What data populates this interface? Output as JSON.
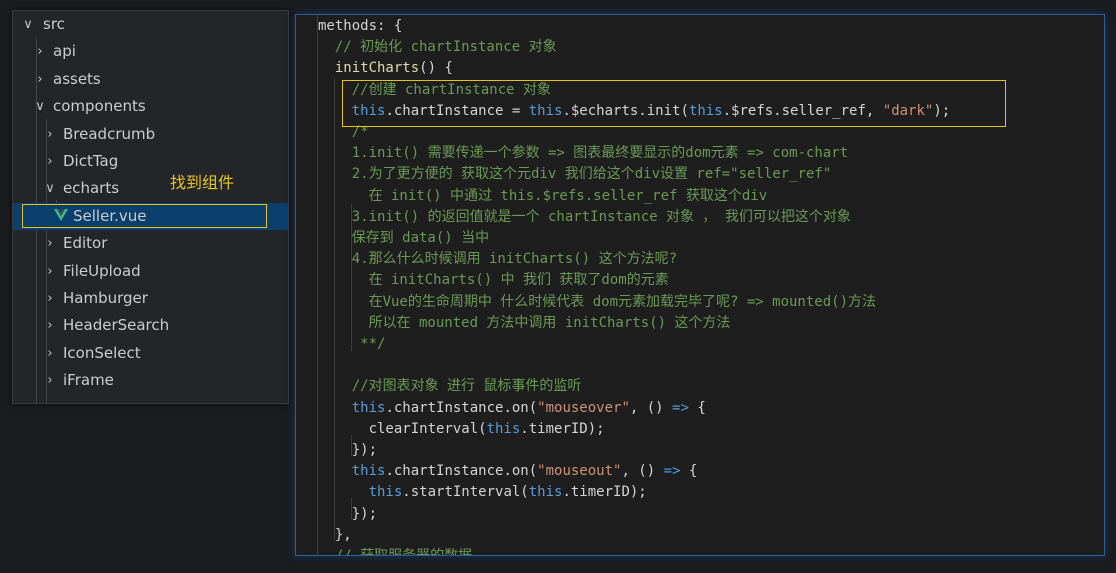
{
  "explorer": {
    "items": [
      {
        "label": "src",
        "chevron": "down",
        "depth": 0
      },
      {
        "label": "api",
        "chevron": "right",
        "depth": 1
      },
      {
        "label": "assets",
        "chevron": "right",
        "depth": 1
      },
      {
        "label": "components",
        "chevron": "down",
        "depth": 1
      },
      {
        "label": "Breadcrumb",
        "chevron": "right",
        "depth": 2
      },
      {
        "label": "DictTag",
        "chevron": "right",
        "depth": 2
      },
      {
        "label": "echarts",
        "chevron": "down",
        "depth": 2
      },
      {
        "label": "Seller.vue",
        "chevron": "",
        "depth": 3,
        "icon": "vue-icon",
        "selected": true
      },
      {
        "label": "Editor",
        "chevron": "right",
        "depth": 2
      },
      {
        "label": "FileUpload",
        "chevron": "right",
        "depth": 2
      },
      {
        "label": "Hamburger",
        "chevron": "right",
        "depth": 2
      },
      {
        "label": "HeaderSearch",
        "chevron": "right",
        "depth": 2
      },
      {
        "label": "IconSelect",
        "chevron": "right",
        "depth": 2
      },
      {
        "label": "iFrame",
        "chevron": "right",
        "depth": 2
      }
    ],
    "annotation": "找到组件"
  },
  "editor": {
    "lines": [
      [
        [
          "plain",
          "methods: {"
        ]
      ],
      [
        [
          "comment",
          "  // 初始化 chartInstance 对象"
        ]
      ],
      [
        [
          "func",
          "  initCharts"
        ],
        [
          "plain",
          "() {"
        ]
      ],
      [
        [
          "comment",
          "    //创建 chartInstance 对象"
        ]
      ],
      [
        [
          "keyword",
          "    this"
        ],
        [
          "plain",
          ".chartInstance = "
        ],
        [
          "keyword",
          "this"
        ],
        [
          "plain",
          ".$echarts.init("
        ],
        [
          "keyword",
          "this"
        ],
        [
          "plain",
          ".$refs.seller_ref, "
        ],
        [
          "string",
          "\"dark\""
        ],
        [
          "plain",
          ");"
        ]
      ],
      [
        [
          "comment",
          "    /*"
        ]
      ],
      [
        [
          "comment",
          "    1.init() 需要传递一个参数 => 图表最终要显示的dom元素 => com-chart"
        ]
      ],
      [
        [
          "comment",
          "    2.为了更方便的 获取这个元div 我们给这个div设置 ref=\"seller_ref\""
        ]
      ],
      [
        [
          "comment",
          "      在 init() 中通过 this.$refs.seller_ref 获取这个div"
        ]
      ],
      [
        [
          "comment",
          "    3.init() 的返回值就是一个 chartInstance 对象 ， 我们可以把这个对象"
        ]
      ],
      [
        [
          "comment",
          "    保存到 data() 当中"
        ]
      ],
      [
        [
          "comment",
          "    4.那么什么时候调用 initCharts() 这个方法呢?"
        ]
      ],
      [
        [
          "comment",
          "      在 initCharts() 中 我们 获取了dom的元素"
        ]
      ],
      [
        [
          "comment",
          "      在Vue的生命周期中 什么时候代表 dom元素加载完毕了呢? => mounted()方法"
        ]
      ],
      [
        [
          "comment",
          "      所以在 mounted 方法中调用 initCharts() 这个方法"
        ]
      ],
      [
        [
          "comment",
          "     **/"
        ]
      ],
      [
        [
          "plain",
          ""
        ]
      ],
      [
        [
          "comment",
          "    //对图表对象 进行 鼠标事件的监听"
        ]
      ],
      [
        [
          "keyword",
          "    this"
        ],
        [
          "plain",
          ".chartInstance.on("
        ],
        [
          "string",
          "\"mouseover\""
        ],
        [
          "plain",
          ", () "
        ],
        [
          "keyword",
          "=>"
        ],
        [
          "plain",
          " {"
        ]
      ],
      [
        [
          "plain",
          "      clearInterval("
        ],
        [
          "keyword",
          "this"
        ],
        [
          "plain",
          ".timerID);"
        ]
      ],
      [
        [
          "plain",
          "    });"
        ]
      ],
      [
        [
          "keyword",
          "    this"
        ],
        [
          "plain",
          ".chartInstance.on("
        ],
        [
          "string",
          "\"mouseout\""
        ],
        [
          "plain",
          ", () "
        ],
        [
          "keyword",
          "=>"
        ],
        [
          "plain",
          " {"
        ]
      ],
      [
        [
          "plain",
          "      "
        ],
        [
          "keyword",
          "this"
        ],
        [
          "plain",
          ".startInterval("
        ],
        [
          "keyword",
          "this"
        ],
        [
          "plain",
          ".timerID);"
        ]
      ],
      [
        [
          "plain",
          "    });"
        ]
      ],
      [
        [
          "plain",
          "  },"
        ]
      ],
      [
        [
          "comment",
          "  // 获取服务器的数据"
        ]
      ]
    ]
  }
}
